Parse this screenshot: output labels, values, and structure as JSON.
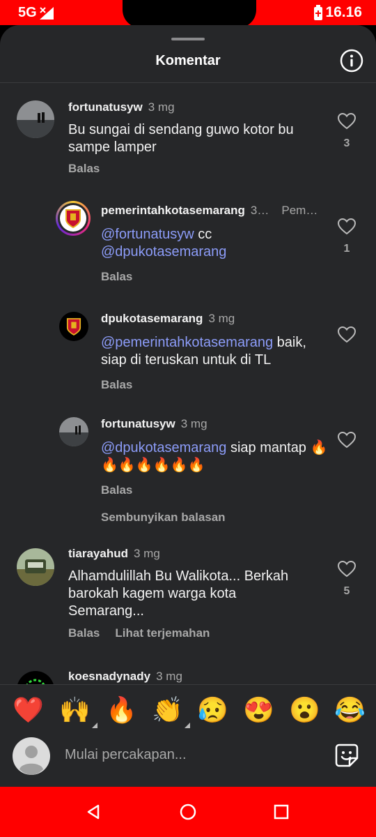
{
  "status": {
    "network": "5G",
    "time": "16.16"
  },
  "header": {
    "title": "Komentar"
  },
  "comments": [
    {
      "username": "fortunatusyw",
      "time": "3 mg",
      "text": "Bu sungai di sendang guwo kotor bu sampe lamper",
      "reply": "Balas",
      "likes": "3"
    },
    {
      "username": "pemerintahkotasemarang",
      "time": "3…",
      "extra": "Pem…",
      "mention1": "@fortunatusyw",
      "text_mid": " cc",
      "mention2": "@dpukotasemarang",
      "reply": "Balas",
      "likes": "1"
    },
    {
      "username": "dpukotasemarang",
      "time": "3 mg",
      "mention": "@pemerintahkotasemarang",
      "text": " baik, siap di teruskan untuk di TL",
      "reply": "Balas"
    },
    {
      "username": "fortunatusyw",
      "time": "3 mg",
      "mention": "@dpukotasemarang",
      "text": " siap mantap 🔥🔥🔥🔥🔥🔥🔥",
      "reply": "Balas"
    },
    {
      "username": "tiarayahud",
      "time": "3 mg",
      "text": "Alhamdulillah Bu Walikota... Berkah barokah kagem warga kota Semarang...",
      "reply": "Balas",
      "translate": "Lihat terjemahan",
      "likes": "5"
    },
    {
      "username": "koesnadynady",
      "time": "3 mg"
    }
  ],
  "hide_replies": "Sembunyikan balasan",
  "emoji_bar": {
    "heart": "❤️",
    "raised_hands": "🙌",
    "fire": "🔥",
    "clap": "👏",
    "sad": "😥",
    "heart_eyes": "😍",
    "surprised": "😮",
    "laughing": "😂"
  },
  "composer": {
    "placeholder": "Mulai percakapan..."
  },
  "colors": {
    "status_bar": "#ff0000",
    "sheet": "#262729",
    "mention": "#8c9cf8"
  }
}
